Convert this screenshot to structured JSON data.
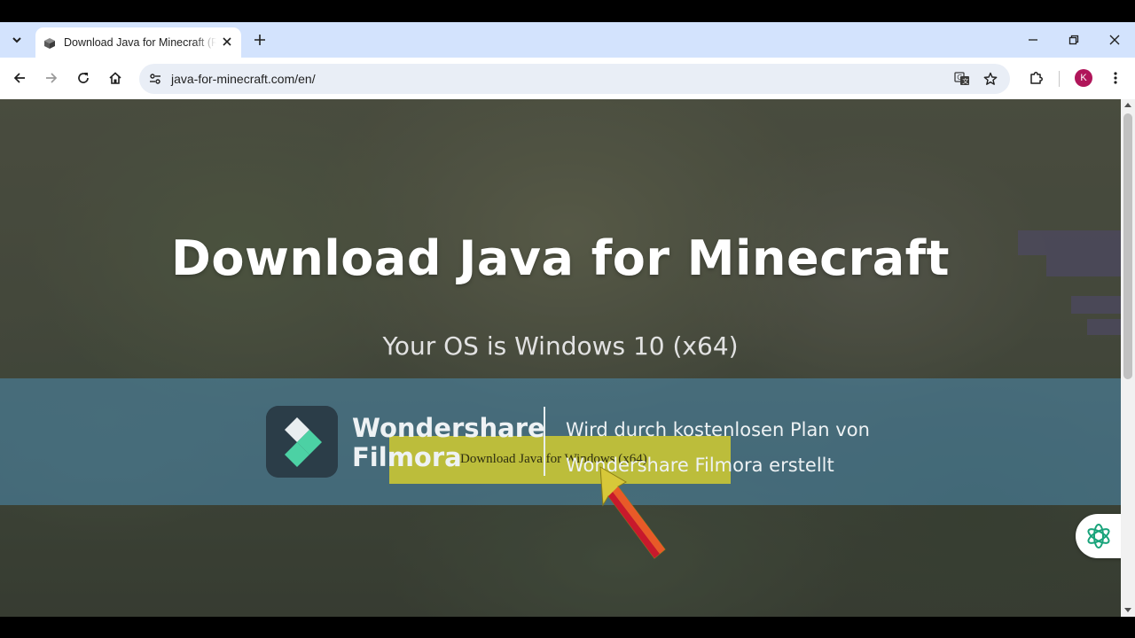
{
  "browser": {
    "tab": {
      "title": "Download Java for Minecraft (R",
      "favicon": "minecraft-block-icon"
    },
    "url": "java-for-minecraft.com/en/",
    "profile_initial": "K",
    "profile_color": "#b0165a",
    "accent_color": "#d3e3fd"
  },
  "page": {
    "title": "Download Java for Minecraft",
    "subtitle": "Your OS is Windows 10 (x64)",
    "download_button_label": "Download Java for Windows (x64)"
  },
  "watermark": {
    "brand_line1": "Wondershare",
    "brand_line2": "Filmora",
    "message_line1": "Wird durch kostenlosen Plan von",
    "message_line2": "Wondershare Filmora erstellt"
  }
}
